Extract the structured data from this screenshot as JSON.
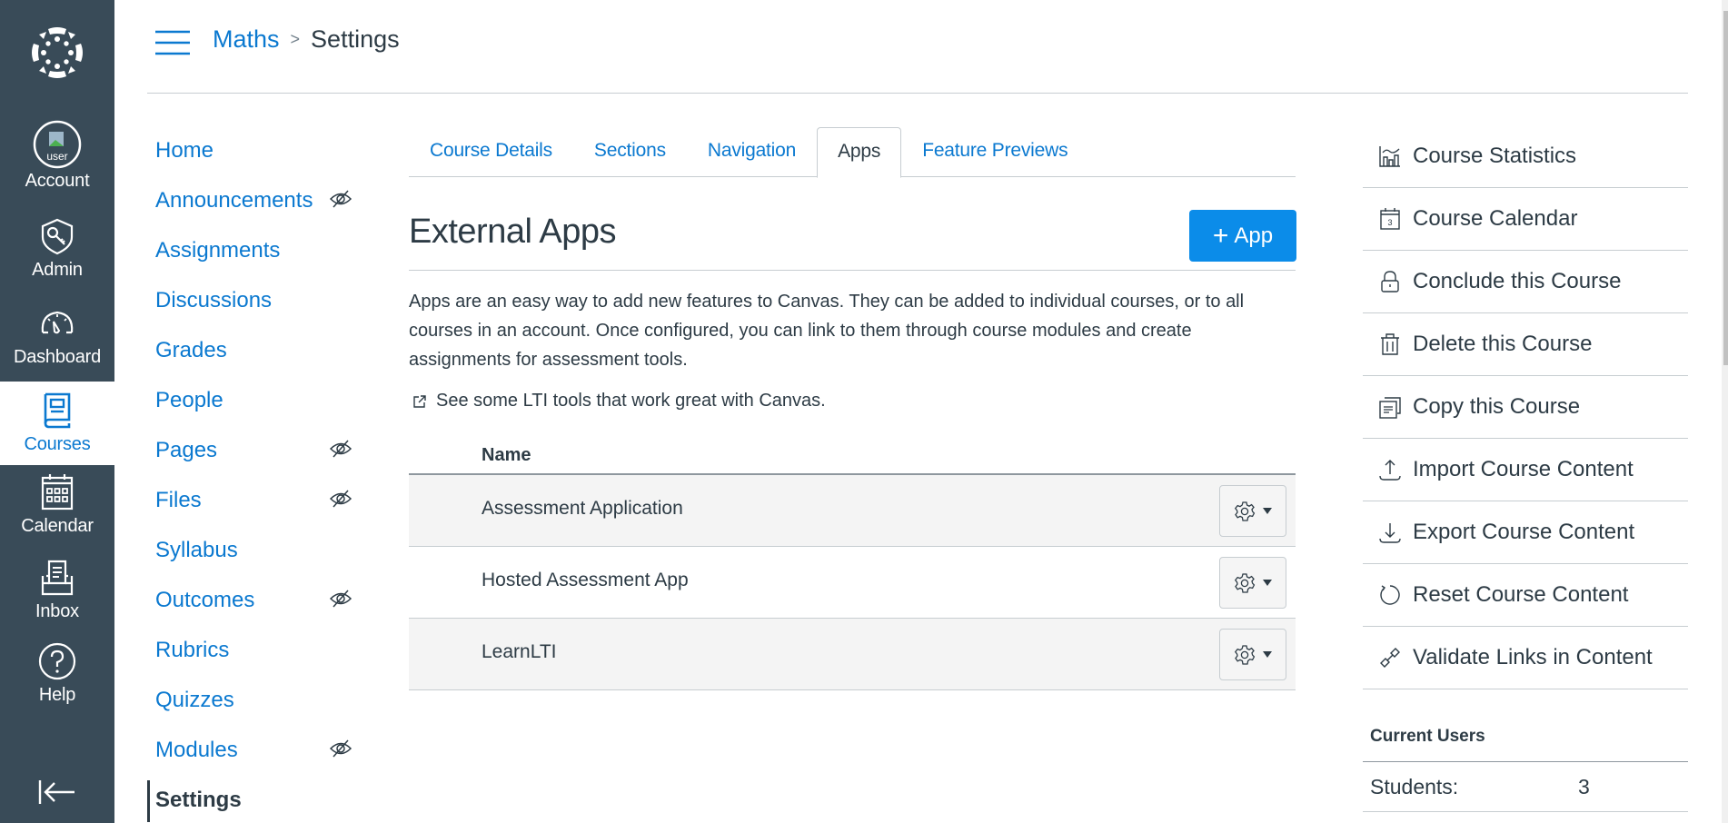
{
  "global_nav": {
    "logo": "canvas-logo",
    "items": [
      {
        "label": "Account",
        "icon": "avatar-icon",
        "avatar_alt": "user"
      },
      {
        "label": "Admin",
        "icon": "shield-key-icon"
      },
      {
        "label": "Dashboard",
        "icon": "speedometer-icon"
      },
      {
        "label": "Courses",
        "icon": "book-icon",
        "active": true
      },
      {
        "label": "Calendar",
        "icon": "calendar-grid-icon"
      },
      {
        "label": "Inbox",
        "icon": "inbox-tray-icon"
      },
      {
        "label": "Help",
        "icon": "question-circle-icon"
      }
    ],
    "collapse_icon": "collapse-arrow-icon"
  },
  "header": {
    "breadcrumb": {
      "course": "Maths",
      "separator": ">",
      "current": "Settings"
    }
  },
  "course_nav": {
    "items": [
      {
        "label": "Home",
        "hidden": false
      },
      {
        "label": "Announcements",
        "hidden": true
      },
      {
        "label": "Assignments",
        "hidden": false
      },
      {
        "label": "Discussions",
        "hidden": false
      },
      {
        "label": "Grades",
        "hidden": false
      },
      {
        "label": "People",
        "hidden": false
      },
      {
        "label": "Pages",
        "hidden": true
      },
      {
        "label": "Files",
        "hidden": true
      },
      {
        "label": "Syllabus",
        "hidden": false
      },
      {
        "label": "Outcomes",
        "hidden": true
      },
      {
        "label": "Rubrics",
        "hidden": false
      },
      {
        "label": "Quizzes",
        "hidden": false
      },
      {
        "label": "Modules",
        "hidden": true
      },
      {
        "label": "Settings",
        "hidden": false,
        "active": true
      }
    ]
  },
  "tabs": [
    {
      "label": "Course Details"
    },
    {
      "label": "Sections"
    },
    {
      "label": "Navigation"
    },
    {
      "label": "Apps",
      "active": true
    },
    {
      "label": "Feature Previews"
    }
  ],
  "main": {
    "title": "External Apps",
    "add_button": {
      "plus": "+",
      "label": "App"
    },
    "description": "Apps are an easy way to add new features to Canvas. They can be added to individual courses, or to all courses in an account. Once configured, you can link to them through course modules and create assignments for assessment tools.",
    "lti_link": "See some LTI tools that work great with Canvas.",
    "table": {
      "header_name": "Name",
      "rows": [
        {
          "name": "Assessment Application"
        },
        {
          "name": "Hosted Assessment App"
        },
        {
          "name": "LearnLTI"
        }
      ]
    }
  },
  "right_sidebar": {
    "items": [
      {
        "label": "Course Statistics",
        "icon": "statistics-icon"
      },
      {
        "label": "Course Calendar",
        "icon": "calendar-day-icon",
        "day": "3"
      },
      {
        "label": "Conclude this Course",
        "icon": "lock-icon"
      },
      {
        "label": "Delete this Course",
        "icon": "trash-icon"
      },
      {
        "label": "Copy this Course",
        "icon": "copy-icon"
      },
      {
        "label": "Import Course Content",
        "icon": "upload-icon"
      },
      {
        "label": "Export Course Content",
        "icon": "download-icon"
      },
      {
        "label": "Reset Course Content",
        "icon": "reset-icon"
      },
      {
        "label": "Validate Links in Content",
        "icon": "link-icon"
      }
    ],
    "current_users": {
      "heading": "Current Users",
      "rows": [
        {
          "label": "Students:",
          "value": "3"
        }
      ]
    }
  },
  "colors": {
    "nav_bg": "#394B58",
    "link": "#0B79D0",
    "primary_button": "#0B8CE9",
    "text": "#2D3B45",
    "row_alt": "#F4F4F4"
  }
}
